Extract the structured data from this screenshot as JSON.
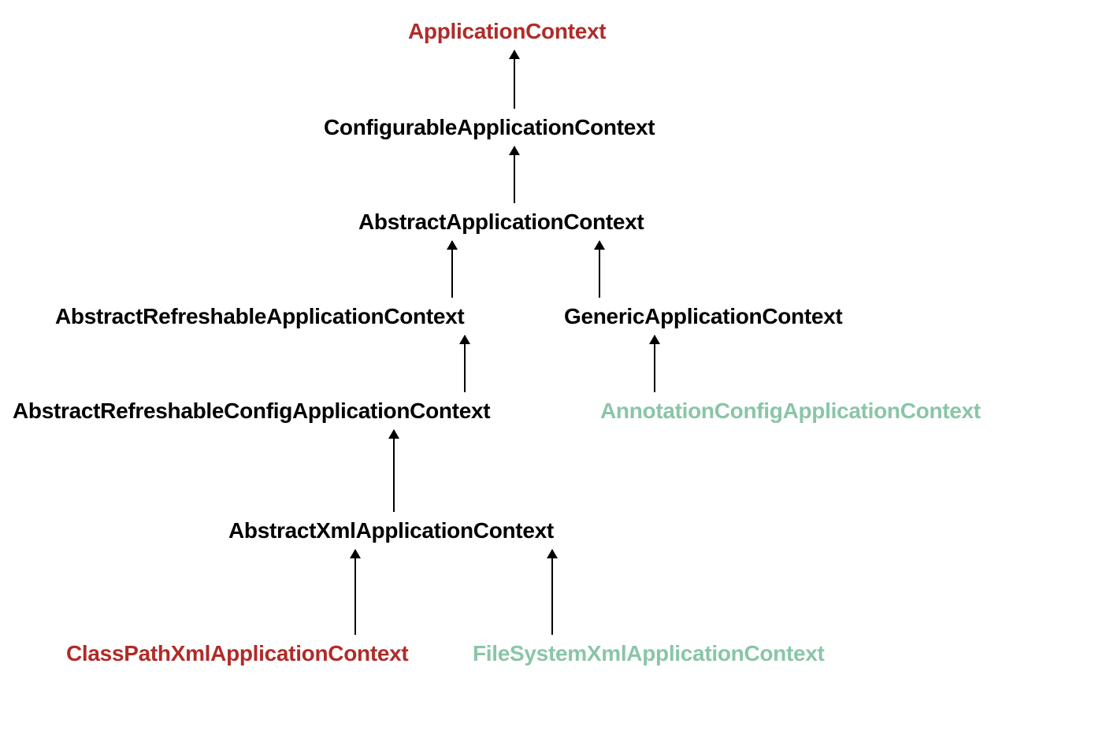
{
  "nodes": {
    "application_context": "ApplicationContext",
    "configurable_application_context": "ConfigurableApplicationContext",
    "abstract_application_context": "AbstractApplicationContext",
    "abstract_refreshable_application_context": "AbstractRefreshableApplicationContext",
    "generic_application_context": "GenericApplicationContext",
    "abstract_refreshable_config_application_context": "AbstractRefreshableConfigApplicationContext",
    "annotation_config_application_context": "AnnotationConfigApplicationContext",
    "abstract_xml_application_context": "AbstractXmlApplicationContext",
    "class_path_xml_application_context": "ClassPathXmlApplicationContext",
    "file_system_xml_application_context": "FileSystemXmlApplicationContext"
  },
  "colors": {
    "red": "#b02b28",
    "green": "#8ac5a7",
    "black": "#000000"
  }
}
